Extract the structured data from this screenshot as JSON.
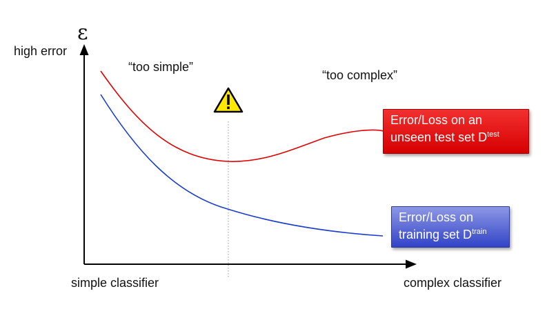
{
  "diagram": {
    "y_axis_symbol": "ε",
    "y_axis_label": "high error",
    "x_axis_left_label": "simple classifier",
    "x_axis_right_label": "complex classifier",
    "region_left": "“too simple”",
    "region_right": "“too complex”",
    "warning_icon": "warning-triangle",
    "test_curve_label": {
      "line1": "Error/Loss on an",
      "line2": "unseen test set D",
      "sup": "test"
    },
    "train_curve_label": {
      "line1": "Error/Loss on",
      "line2": "training set D",
      "sup": "train"
    },
    "colors": {
      "test_curve": "#e00000",
      "train_curve": "#1a3ccc",
      "warning_fill": "#ffe800"
    }
  }
}
